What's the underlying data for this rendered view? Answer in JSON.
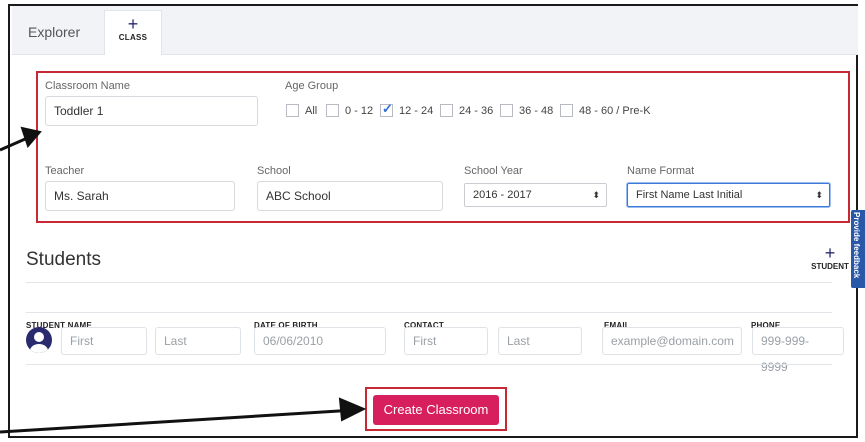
{
  "tabs": {
    "explorer_label": "Explorer",
    "add_class_plus": "+",
    "add_class_label": "CLASS"
  },
  "class_form": {
    "classroom_name": {
      "label": "Classroom Name",
      "value": "Toddler 1"
    },
    "age_group": {
      "label": "Age Group",
      "options": [
        {
          "label": "All",
          "checked": false
        },
        {
          "label": "0 - 12",
          "checked": false
        },
        {
          "label": "12 - 24",
          "checked": true
        },
        {
          "label": "24 - 36",
          "checked": false
        },
        {
          "label": "36 - 48",
          "checked": false
        },
        {
          "label": "48 - 60 / Pre-K",
          "checked": false
        }
      ]
    },
    "teacher": {
      "label": "Teacher",
      "value": "Ms. Sarah"
    },
    "school": {
      "label": "School",
      "value": "ABC School"
    },
    "school_year": {
      "label": "School Year",
      "value": "2016 - 2017"
    },
    "name_format": {
      "label": "Name Format",
      "value": "First Name Last Initial"
    }
  },
  "students": {
    "title": "Students",
    "add_plus": "+",
    "add_label": "STUDENT",
    "columns": [
      "STUDENT NAME",
      "DATE OF BIRTH",
      "CONTACT",
      "EMAIL",
      "PHONE"
    ],
    "row": {
      "first_placeholder": "First",
      "last_placeholder": "Last",
      "dob_placeholder": "06/06/2010",
      "contact_first_placeholder": "First",
      "contact_last_placeholder": "Last",
      "email_placeholder": "example@domain.com",
      "phone_placeholder": "999-999-9999"
    }
  },
  "feedback_label": "Provide feedback",
  "create_button_label": "Create Classroom",
  "colors": {
    "accent": "#d81f5e",
    "highlight_box": "#c62933",
    "navy": "#2a2a6e"
  }
}
